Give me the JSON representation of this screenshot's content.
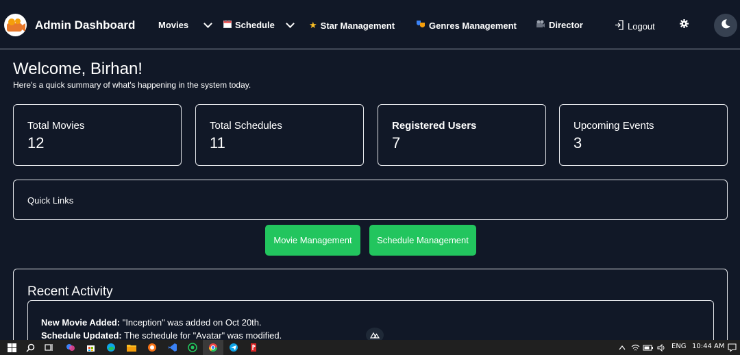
{
  "nav": {
    "brand": "Admin Dashboard",
    "movies": "Movies",
    "schedule": "Schedule",
    "star": "Star Management",
    "genres": "Genres Management",
    "director": "Director",
    "logout": "Logout"
  },
  "welcome": {
    "title": "Welcome, Birhan!",
    "subtitle": "Here's a quick summary of what's happening in the system today."
  },
  "stats": [
    {
      "label": "Total Movies",
      "value": "12"
    },
    {
      "label": "Total Schedules",
      "value": "11"
    },
    {
      "label": "Registered Users",
      "value": "7"
    },
    {
      "label": "Upcoming Events",
      "value": "3"
    }
  ],
  "quick_links": {
    "title": "Quick Links",
    "movie_btn": "Movie Management",
    "schedule_btn": "Schedule Management"
  },
  "recent": {
    "title": "Recent Activity",
    "items": [
      {
        "label": "New Movie Added:",
        "text": " \"Inception\" was added on Oct 20th."
      },
      {
        "label": "Schedule Updated:",
        "text": " The schedule for \"Avatar\" was modified."
      }
    ]
  },
  "taskbar": {
    "lang": "ENG",
    "time": "10:44 AM"
  },
  "colors": {
    "background": "#111827",
    "accent_green": "#22c55e",
    "border": "#e5e7eb"
  }
}
